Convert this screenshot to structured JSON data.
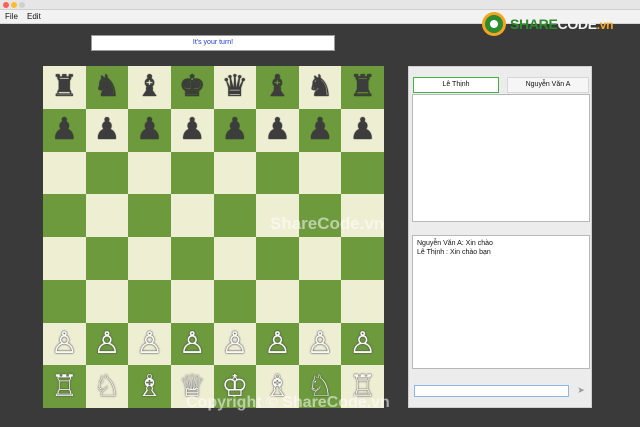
{
  "menu": {
    "file": "File",
    "edit": "Edit"
  },
  "logo": {
    "share": "SHARE",
    "code": "CODE",
    "vn": ".vn"
  },
  "status": {
    "message": "It's your turn!"
  },
  "board": {
    "rows": [
      [
        "♜",
        "♞",
        "♝",
        "♚",
        "♛",
        "♝",
        "♞",
        "♜"
      ],
      [
        "♟",
        "♟",
        "♟",
        "♟",
        "♟",
        "♟",
        "♟",
        "♟"
      ],
      [
        "",
        "",
        "",
        "",
        "",
        "",
        "",
        ""
      ],
      [
        "",
        "",
        "",
        "",
        "",
        "",
        "",
        ""
      ],
      [
        "",
        "",
        "",
        "",
        "",
        "",
        "",
        ""
      ],
      [
        "",
        "",
        "",
        "",
        "",
        "",
        "",
        ""
      ],
      [
        "♙",
        "♙",
        "♙",
        "♙",
        "♙",
        "♙",
        "♙",
        "♙"
      ],
      [
        "♖",
        "♘",
        "♗",
        "♕",
        "♔",
        "♗",
        "♘",
        "♖"
      ]
    ],
    "light_color": "#eeeed2",
    "dark_color": "#6c9a3c"
  },
  "panel": {
    "tabs": [
      {
        "label": "Lê Thịnh"
      },
      {
        "label": "Nguyễn Văn A"
      }
    ],
    "chat": [
      "Nguyễn Văn A: Xin chào",
      "Lê Thịnh : Xin chào bạn"
    ],
    "input_value": "",
    "send_icon": "send-arrow-icon"
  },
  "watermark": {
    "middle": "ShareCode.vn",
    "bottom": "Copyright © ShareCode.vn"
  }
}
